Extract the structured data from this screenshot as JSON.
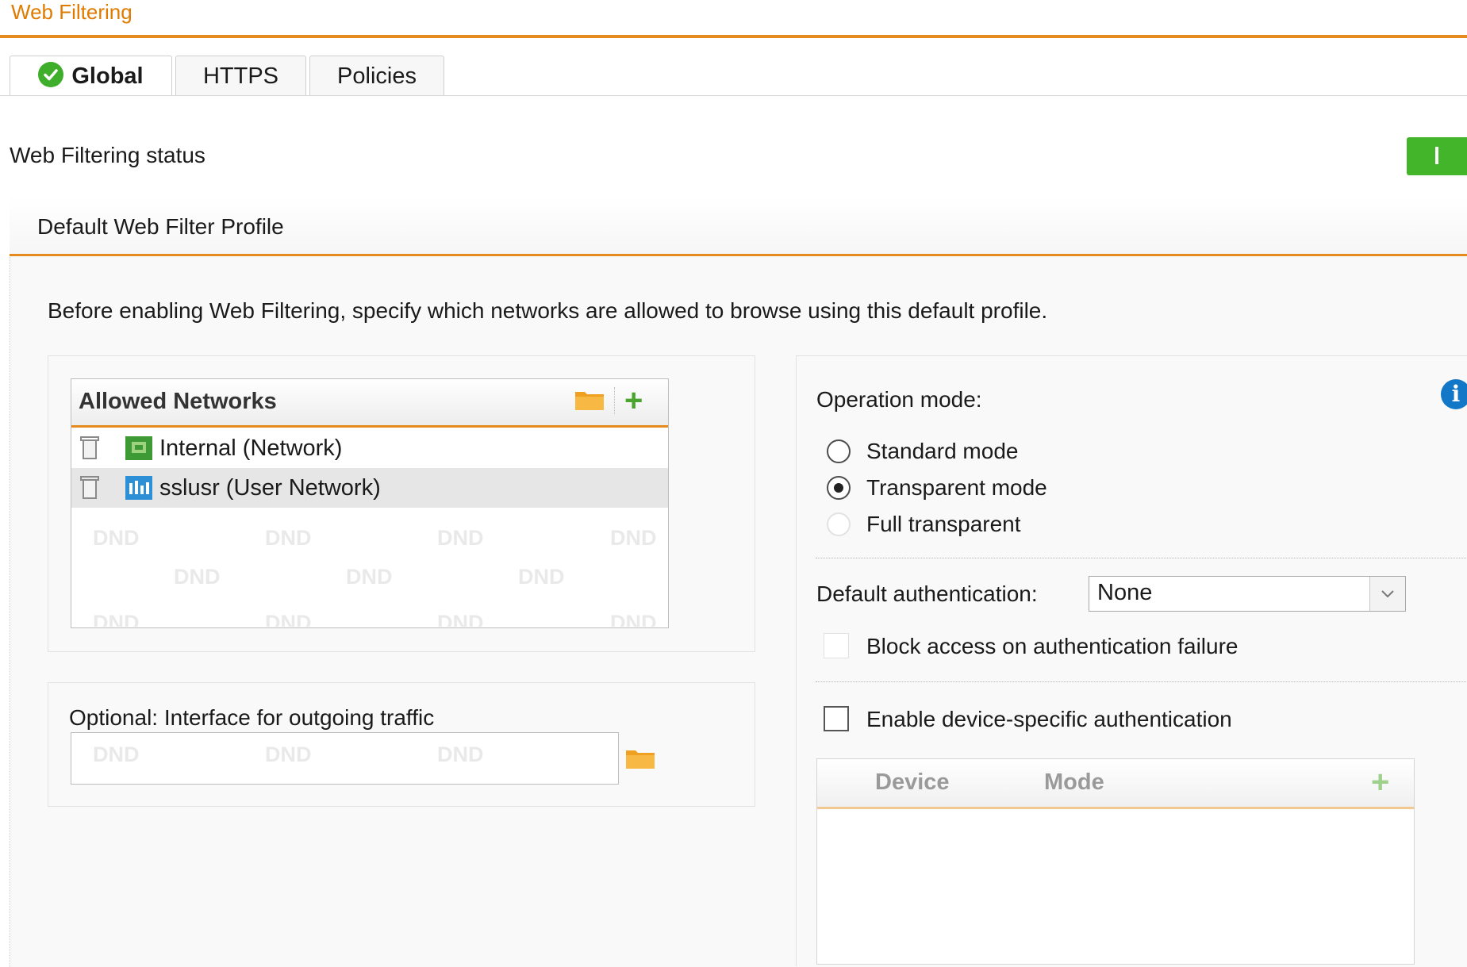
{
  "header": {
    "title": "Web Filtering"
  },
  "tabs": [
    {
      "label": "Global",
      "active": true,
      "icon": "check-circle-icon"
    },
    {
      "label": "HTTPS",
      "active": false
    },
    {
      "label": "Policies",
      "active": false
    }
  ],
  "status": {
    "label": "Web Filtering status",
    "enabled": true,
    "toggle_symbol": "I"
  },
  "profile": {
    "title": "Default Web Filter Profile",
    "intro": "Before enabling Web Filtering, specify which networks are allowed to browse using this default profile."
  },
  "allowed_networks": {
    "title": "Allowed Networks",
    "items": [
      {
        "label": "Internal (Network)",
        "icon": "network-icon"
      },
      {
        "label": "sslusr (User Network)",
        "icon": "user-network-icon"
      }
    ],
    "dnd_text": "DND"
  },
  "outgoing": {
    "label": "Optional: Interface for outgoing traffic",
    "dnd_text": "DND"
  },
  "operation": {
    "label": "Operation mode:",
    "options": [
      {
        "label": "Standard mode",
        "selected": false,
        "disabled": false
      },
      {
        "label": "Transparent mode",
        "selected": true,
        "disabled": false
      },
      {
        "label": "Full transparent",
        "selected": false,
        "disabled": true
      }
    ]
  },
  "auth": {
    "label": "Default authentication:",
    "value": "None",
    "block_label": "Block access on authentication failure",
    "device_label": "Enable device-specific authentication"
  },
  "device_table": {
    "columns": [
      "Device",
      "Mode"
    ]
  },
  "colors": {
    "accent": "#e58a1f",
    "title": "#e07b00",
    "toggle_on": "#43b52a",
    "add": "#4aa52e",
    "info": "#1277c7"
  }
}
